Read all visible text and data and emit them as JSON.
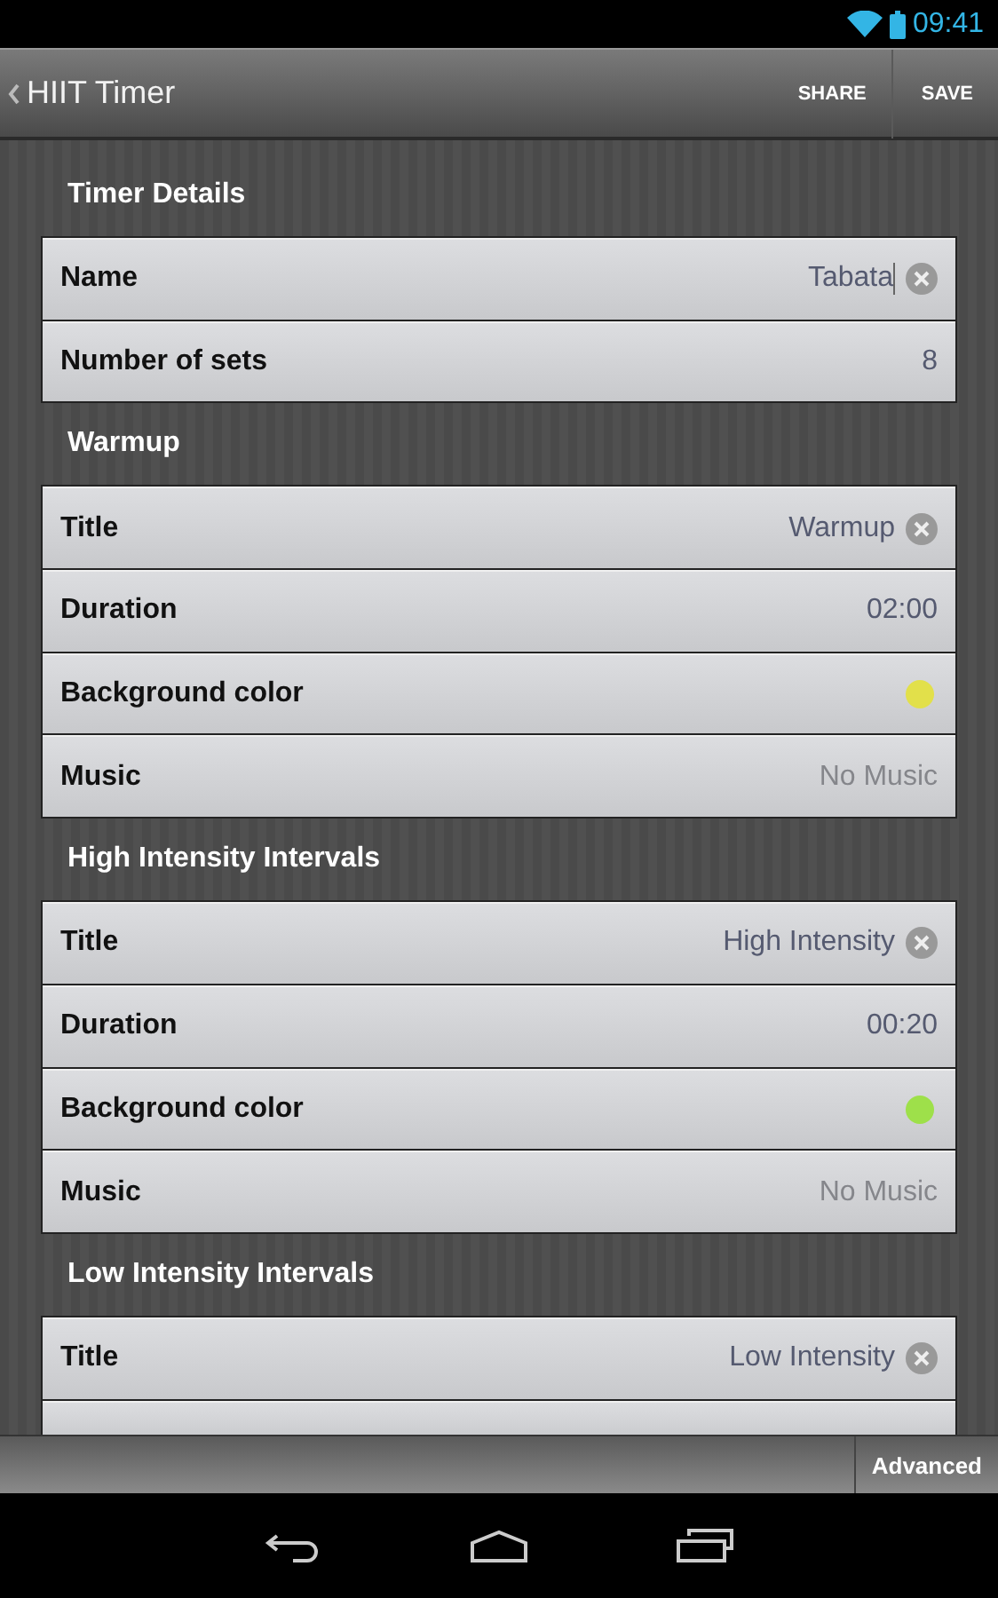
{
  "status_bar": {
    "time": "09:41"
  },
  "action_bar": {
    "title": "HIIT Timer",
    "actions": [
      "SHARE",
      "SAVE"
    ]
  },
  "sections": [
    {
      "title": "Timer Details",
      "rows": [
        {
          "kind": "text",
          "label": "Name",
          "value": "Tabata",
          "focused": true
        },
        {
          "kind": "value",
          "label": "Number of sets",
          "value": "8"
        }
      ]
    },
    {
      "title": "Warmup",
      "rows": [
        {
          "kind": "text",
          "label": "Title",
          "value": "Warmup",
          "focused": false
        },
        {
          "kind": "value",
          "label": "Duration",
          "value": "02:00"
        },
        {
          "kind": "color",
          "label": "Background color",
          "color": "#e2e04a"
        },
        {
          "kind": "music",
          "label": "Music",
          "placeholder": "No Music"
        }
      ]
    },
    {
      "title": "High Intensity Intervals",
      "rows": [
        {
          "kind": "text",
          "label": "Title",
          "value": "High Intensity",
          "focused": false
        },
        {
          "kind": "value",
          "label": "Duration",
          "value": "00:20"
        },
        {
          "kind": "color",
          "label": "Background color",
          "color": "#9ee04a"
        },
        {
          "kind": "music",
          "label": "Music",
          "placeholder": "No Music"
        }
      ]
    },
    {
      "title": "Low Intensity Intervals",
      "rows": [
        {
          "kind": "text",
          "label": "Title",
          "value": "Low Intensity",
          "focused": false
        },
        {
          "kind": "hidden"
        }
      ]
    }
  ],
  "bottom_bar": {
    "button": "Advanced"
  }
}
